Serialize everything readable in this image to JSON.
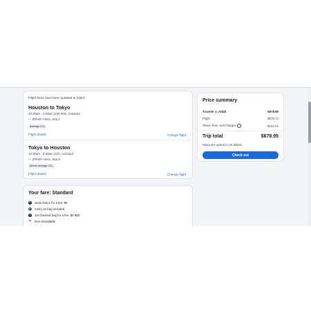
{
  "flights": {
    "notice": "Flight fares have been updated to match",
    "legs": [
      {
        "title": "Houston to Tokyo",
        "times": "10:30am - 2:20pm (13h 50m, nonstop)",
        "airline": "— ZIPAIR • Mon, Sep 1",
        "badge": "Average CO₂",
        "details_link": "Flight details",
        "change_link": "Change flight"
      },
      {
        "title": "Tokyo to Houston",
        "times": "10:30am - 8:30am (12h, nonstop)",
        "airline": "— ZIPAIR • Mon, Sep 8",
        "badge": "Above average CO₂",
        "details_link": "Flight details",
        "change_link": "Change flight"
      }
    ]
  },
  "fare": {
    "title": "Your fare: Standard",
    "items": [
      {
        "icon": "dollar-icon",
        "text": "Seat choice for a fee: $5"
      },
      {
        "icon": "check-icon",
        "text": "Carry-on bag included"
      },
      {
        "icon": "dollar-icon",
        "text": "1st checked bag for a fee: $0-$60"
      },
      {
        "icon": "close-icon",
        "text": "Non-refundable"
      }
    ]
  },
  "price_summary": {
    "title": "Price summary",
    "traveler_label": "Traveler 1: Adult",
    "traveler_value": "$678.95",
    "flight_label": "Flight",
    "flight_value": "$575.73",
    "taxes_label": "Taxes, fees, and charges",
    "taxes_value": "$103.22",
    "total_label": "Trip total",
    "total_value": "$678.95",
    "currency_note": "Rates are quoted in US dollars",
    "checkout_label": "Check out"
  },
  "colors": {
    "accent": "#1668e3",
    "background": "#f3f4f7",
    "card": "#ffffff"
  }
}
